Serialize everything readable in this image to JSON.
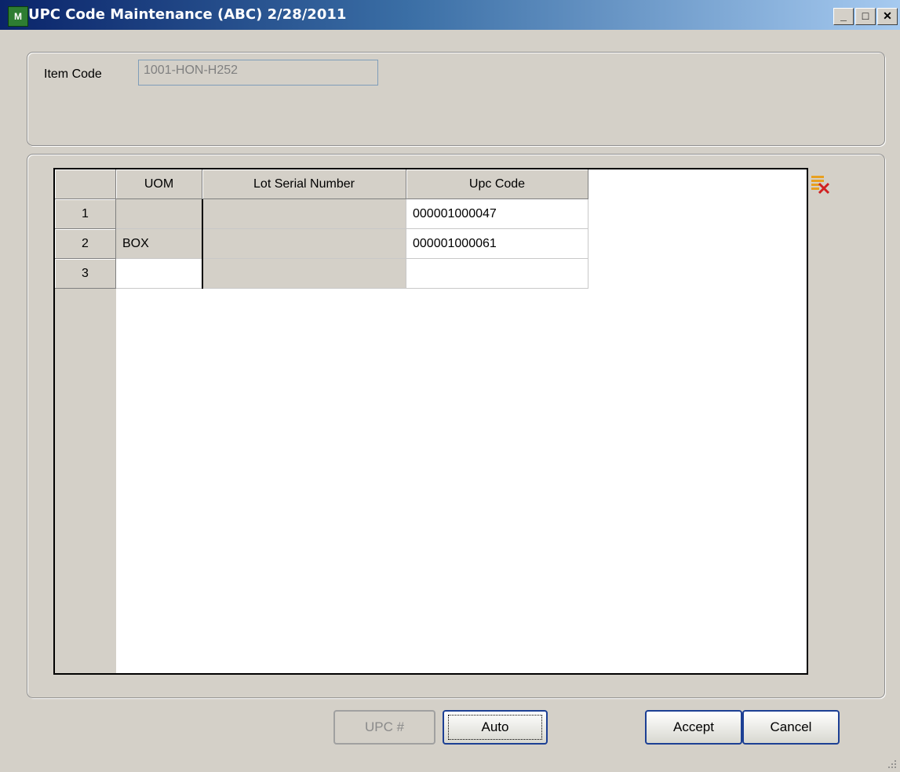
{
  "window": {
    "title": "UPC Code Maintenance (ABC) 2/28/2011",
    "controls": {
      "minimize": "_",
      "maximize": "□",
      "close": "✕"
    }
  },
  "header": {
    "item_code_label": "Item Code",
    "item_code_value": "1001-HON-H252"
  },
  "grid": {
    "columns": [
      "UOM",
      "Lot Serial Number",
      "Upc Code"
    ],
    "rows": [
      {
        "num": "1",
        "uom": "",
        "lot_serial": "",
        "upc": "000001000047"
      },
      {
        "num": "2",
        "uom": "BOX",
        "lot_serial": "",
        "upc": "000001000061"
      },
      {
        "num": "3",
        "uom": "",
        "lot_serial": "",
        "upc": ""
      }
    ]
  },
  "buttons": {
    "upc": "UPC #",
    "auto": "Auto",
    "accept": "Accept",
    "cancel": "Cancel"
  },
  "icons": {
    "app": "mas90-app-icon",
    "delete_row": "delete-row-icon"
  }
}
